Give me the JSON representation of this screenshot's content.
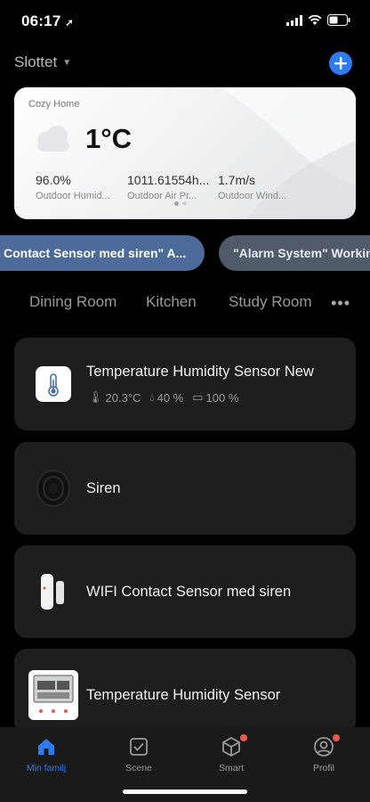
{
  "status_bar": {
    "time": "06:17"
  },
  "header": {
    "home_name": "Slottet"
  },
  "weather": {
    "card_title": "Cozy Home",
    "temperature": "1°C",
    "stats": [
      {
        "value": "96.0%",
        "label": "Outdoor Humid..."
      },
      {
        "value": "1011.61554h...",
        "label": "Outdoor Air Pr..."
      },
      {
        "value": "1.7m/s",
        "label": "Outdoor Wind..."
      }
    ]
  },
  "scenes": [
    {
      "label": "Contact Sensor med siren\" A..."
    },
    {
      "label": "\"Alarm System\" Workin"
    }
  ],
  "rooms": [
    "Dining Room",
    "Kitchen",
    "Study Room"
  ],
  "devices": [
    {
      "name": "Temperature Humidity Sensor New",
      "temp": "20.3°C",
      "humidity": "40 %",
      "battery": "100 %"
    },
    {
      "name": "Siren"
    },
    {
      "name": "WIFI Contact Sensor med siren"
    },
    {
      "name": "Temperature Humidity Sensor"
    }
  ],
  "tabbar": [
    {
      "label": "Min familj"
    },
    {
      "label": "Scene"
    },
    {
      "label": "Smart"
    },
    {
      "label": "Profil"
    }
  ],
  "colors": {
    "accent": "#2f7bf5",
    "badge": "#e35b4f",
    "card": "#1e1e1e"
  }
}
